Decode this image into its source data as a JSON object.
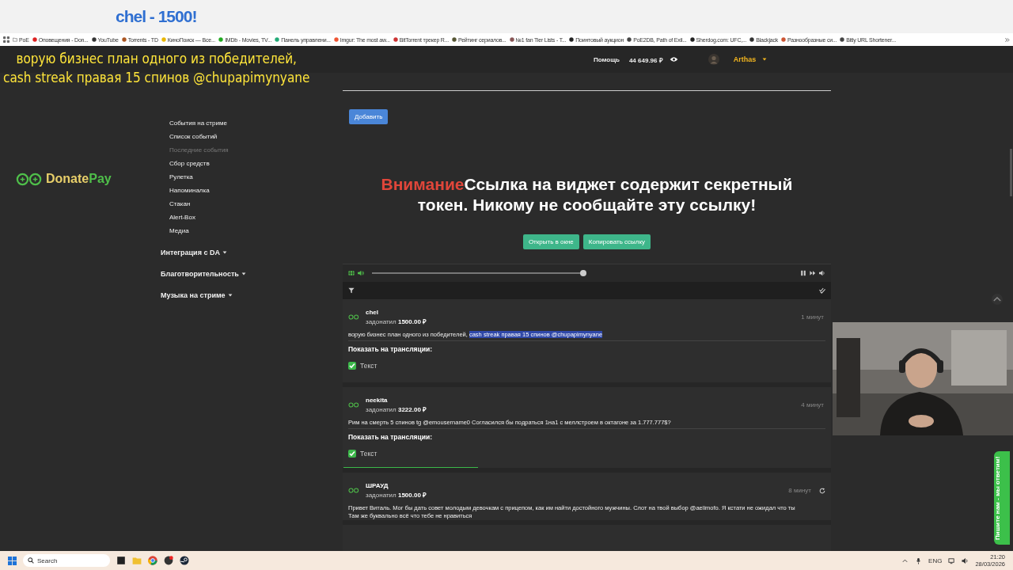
{
  "stream_overlay": {
    "alert": "chel - 1500!",
    "caption_lines": [
      "ворую бизнес план одного из победителей,",
      "cash streak правая 15 спинов @chupapimynyane"
    ]
  },
  "bookmarks": [
    {
      "label": "PoE",
      "kind": "folder"
    },
    {
      "label": "Оповещения - Don...",
      "kind": "site"
    },
    {
      "label": "YouTube",
      "kind": "site"
    },
    {
      "label": "Torrents - TD",
      "kind": "site"
    },
    {
      "label": "КиноПоиск — Все...",
      "kind": "site"
    },
    {
      "label": "IMDb - Movies, TV...",
      "kind": "site"
    },
    {
      "label": "Панель управлени...",
      "kind": "site"
    },
    {
      "label": "Imgur: The most aw...",
      "kind": "site"
    },
    {
      "label": "BitTorrent трекер R...",
      "kind": "site"
    },
    {
      "label": "Рейтинг сериалов...",
      "kind": "site"
    },
    {
      "label": "№1 fan Tier Lists - T...",
      "kind": "site"
    },
    {
      "label": "Поинтовый аукцион",
      "kind": "site"
    },
    {
      "label": "PoE2DB, Path of Exil...",
      "kind": "site"
    },
    {
      "label": "Sherdog.com: UFC,...",
      "kind": "site"
    },
    {
      "label": "Blackjack",
      "kind": "site"
    },
    {
      "label": "Разнообразные си...",
      "kind": "site"
    },
    {
      "label": "Bitly URL Shortener...",
      "kind": "site"
    }
  ],
  "header": {
    "help": "Помощь",
    "balance": "44 649.96 ₽",
    "user": "Arthas"
  },
  "logo": {
    "first": "Donate",
    "second": "Pay"
  },
  "sidebar": {
    "items": [
      {
        "label": "События на стриме",
        "dimmed": false
      },
      {
        "label": "Список событий",
        "dimmed": false
      },
      {
        "label": "Последние события",
        "dimmed": true
      },
      {
        "label": "Сбор средств",
        "dimmed": false
      },
      {
        "label": "Рулетка",
        "dimmed": false
      },
      {
        "label": "Напоминалка",
        "dimmed": false
      },
      {
        "label": "Стакан",
        "dimmed": false
      },
      {
        "label": "Alert-Box",
        "dimmed": false
      },
      {
        "label": "Медиа",
        "dimmed": false
      }
    ],
    "sections": [
      {
        "label": "Интеграция с DA",
        "expanded": false
      },
      {
        "label": "Благотворительность",
        "expanded": false
      },
      {
        "label": "Музыка на стриме",
        "expanded": false
      }
    ]
  },
  "add_button": "Добавить",
  "warning": {
    "label": "Внимание",
    "text": "Ссылка на виджет содержит секретный токен. Никому не сообщайте эту ссылку!"
  },
  "link_buttons": [
    "Открыть в окне",
    "Копировать ссылку"
  ],
  "player": {
    "level": 1
  },
  "donations": [
    {
      "name": "chel",
      "verb": "задонатил",
      "amount": "1500.00 ₽",
      "time": "1 минут",
      "refresh": false,
      "message": [
        {
          "text": "ворую бизнес план одного из победителей, ",
          "selected": false
        },
        {
          "text": "cash streak правая 15 спинов @chupapimynyane",
          "selected": true
        }
      ],
      "show_label": "Показать на трансляции:",
      "options": [
        {
          "label": "Текст",
          "checked": true
        }
      ]
    },
    {
      "name": "neekita",
      "verb": "задонатил",
      "amount": "3222.00 ₽",
      "time": "4 минут",
      "refresh": false,
      "message": [
        {
          "text": "Рим на смерть 5 спинов tg @emousername0 Согласился бы подраться 1на1 с меллстроем в октагоне за 1.777.777$?",
          "selected": false
        }
      ],
      "show_label": "Показать на трансляции:",
      "options": [
        {
          "label": "Текст",
          "checked": true
        }
      ]
    },
    {
      "name": "ШРАУД",
      "verb": "задонатил",
      "amount": "1500.00 ₽",
      "time": "8 минут",
      "refresh": true,
      "message": [
        {
          "text": "Привет Виталь. Мог бы дать совет молодым девочкам с прицепом, как им найти достойного мужчины. Слот на твой выбор @aelimofo. Я кстати не ожидал что ты",
          "selected": false
        }
      ],
      "message_tail": "Там же буквально всё что тебе не нравиться"
    }
  ],
  "support_tab": "Пишите нам - мы ответим!",
  "taskbar": {
    "search": "Search",
    "language": "ENG",
    "time": "21:20",
    "date": "28/03/2026"
  }
}
